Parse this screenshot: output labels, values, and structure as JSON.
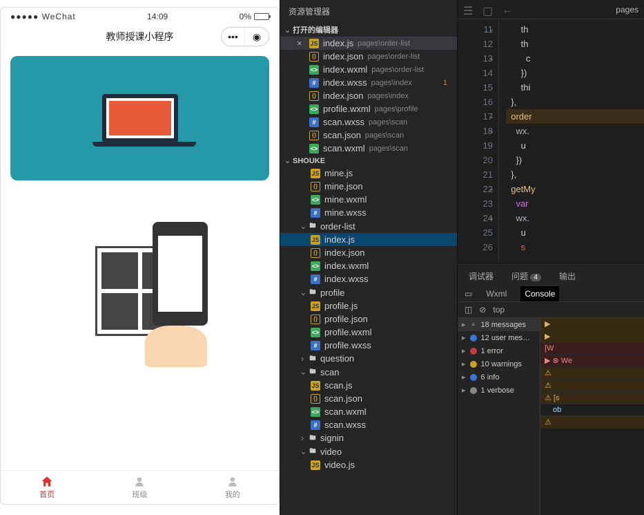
{
  "simulator": {
    "carrier": "●●●●● WeChat",
    "time": "14:09",
    "battery": "0%",
    "title": "教师授课小程序",
    "tabs": [
      {
        "label": "首页",
        "active": true
      },
      {
        "label": "班级",
        "active": false
      },
      {
        "label": "我的",
        "active": false
      }
    ]
  },
  "explorer": {
    "title": "资源管理器",
    "open_editors_label": "打开的编辑器",
    "project_label": "SHOUKE",
    "open_editors": [
      {
        "name": "index.js",
        "path": "pages\\order-list",
        "icon": "js",
        "active": true,
        "close": true
      },
      {
        "name": "index.json",
        "path": "pages\\order-list",
        "icon": "json"
      },
      {
        "name": "index.wxml",
        "path": "pages\\order-list",
        "icon": "wxml"
      },
      {
        "name": "index.wxss",
        "path": "pages\\index",
        "icon": "wxss",
        "warn": "1"
      },
      {
        "name": "index.json",
        "path": "pages\\index",
        "icon": "json"
      },
      {
        "name": "profile.wxml",
        "path": "pages\\profile",
        "icon": "wxml"
      },
      {
        "name": "scan.wxss",
        "path": "pages\\scan",
        "icon": "wxss"
      },
      {
        "name": "scan.json",
        "path": "pages\\scan",
        "icon": "json"
      },
      {
        "name": "scan.wxml",
        "path": "pages\\scan",
        "icon": "wxml"
      }
    ],
    "tree": [
      {
        "type": "file",
        "depth": 3,
        "name": "mine.js",
        "icon": "js"
      },
      {
        "type": "file",
        "depth": 3,
        "name": "mine.json",
        "icon": "json"
      },
      {
        "type": "file",
        "depth": 3,
        "name": "mine.wxml",
        "icon": "wxml"
      },
      {
        "type": "file",
        "depth": 3,
        "name": "mine.wxss",
        "icon": "wxss"
      },
      {
        "type": "folder",
        "depth": 2,
        "name": "order-list",
        "open": true
      },
      {
        "type": "file",
        "depth": 3,
        "name": "index.js",
        "icon": "js",
        "selected": true
      },
      {
        "type": "file",
        "depth": 3,
        "name": "index.json",
        "icon": "json"
      },
      {
        "type": "file",
        "depth": 3,
        "name": "index.wxml",
        "icon": "wxml"
      },
      {
        "type": "file",
        "depth": 3,
        "name": "index.wxss",
        "icon": "wxss"
      },
      {
        "type": "folder",
        "depth": 2,
        "name": "profile",
        "open": true
      },
      {
        "type": "file",
        "depth": 3,
        "name": "profile.js",
        "icon": "js"
      },
      {
        "type": "file",
        "depth": 3,
        "name": "profile.json",
        "icon": "json"
      },
      {
        "type": "file",
        "depth": 3,
        "name": "profile.wxml",
        "icon": "wxml"
      },
      {
        "type": "file",
        "depth": 3,
        "name": "profile.wxss",
        "icon": "wxss"
      },
      {
        "type": "folder",
        "depth": 2,
        "name": "question",
        "open": false
      },
      {
        "type": "folder",
        "depth": 2,
        "name": "scan",
        "open": true
      },
      {
        "type": "file",
        "depth": 3,
        "name": "scan.js",
        "icon": "js"
      },
      {
        "type": "file",
        "depth": 3,
        "name": "scan.json",
        "icon": "json"
      },
      {
        "type": "file",
        "depth": 3,
        "name": "scan.wxml",
        "icon": "wxml"
      },
      {
        "type": "file",
        "depth": 3,
        "name": "scan.wxss",
        "icon": "wxss"
      },
      {
        "type": "folder",
        "depth": 2,
        "name": "signin",
        "open": false
      },
      {
        "type": "folder",
        "depth": 2,
        "name": "video",
        "open": true
      },
      {
        "type": "file",
        "depth": 3,
        "name": "video.js",
        "icon": "js"
      }
    ]
  },
  "editor": {
    "tab_path": "pages",
    "lines": [
      {
        "num": "11",
        "html": "      th"
      },
      {
        "num": "12",
        "html": "      th"
      },
      {
        "num": "13",
        "html": "        c"
      },
      {
        "num": "14",
        "html": "      })"
      },
      {
        "num": "15",
        "html": "      thi"
      },
      {
        "num": "16",
        "html": "  },"
      },
      {
        "num": "17",
        "html": "  <span class='tok-fn'>order</span>",
        "hl": true
      },
      {
        "num": "18",
        "html": "    <span class='tok-obj'>wx</span>."
      },
      {
        "num": "19",
        "html": "      u"
      },
      {
        "num": "20",
        "html": "    })"
      },
      {
        "num": "21",
        "html": "  },"
      },
      {
        "num": "22",
        "html": "  <span class='tok-fn'>getMy</span>"
      },
      {
        "num": "23",
        "html": "    <span class='tok-kw'>var</span>"
      },
      {
        "num": "24",
        "html": "    <span class='tok-obj'>wx</span>."
      },
      {
        "num": "25",
        "html": "      u"
      },
      {
        "num": "26",
        "html": "      <span class='tok-var'>s</span>"
      }
    ],
    "folds": [
      11,
      13,
      17,
      18,
      22,
      24
    ]
  },
  "debugger": {
    "tabs": {
      "debugger": "调试器",
      "problems": "问题",
      "problems_count": "4",
      "output": "输出"
    },
    "subtabs": {
      "wxml": "Wxml",
      "console": "Console"
    },
    "scope": "top",
    "messages": [
      {
        "icon": "msgs",
        "text": "18 messages",
        "head": true
      },
      {
        "icon": "user",
        "text": "12 user mes…"
      },
      {
        "icon": "err",
        "text": "1 error"
      },
      {
        "icon": "warn",
        "text": "10 warnings"
      },
      {
        "icon": "inf2",
        "text": "6 info"
      },
      {
        "icon": "verb",
        "text": "1 verbose"
      }
    ],
    "console": [
      {
        "cls": "warn-bg",
        "text": "▶"
      },
      {
        "cls": "warn-bg",
        "text": "▶"
      },
      {
        "cls": "err-bg",
        "text": "[W"
      },
      {
        "cls": "err-bg",
        "text": "▶ ⊗  We"
      },
      {
        "cls": "warn-bg",
        "text": "⚠"
      },
      {
        "cls": "warn-bg",
        "text": "⚠"
      },
      {
        "cls": "warn-bg",
        "text": "⚠ [s"
      },
      {
        "cls": "obj-bg",
        "text": "ob"
      },
      {
        "cls": "warn-bg",
        "text": "⚠"
      }
    ]
  }
}
